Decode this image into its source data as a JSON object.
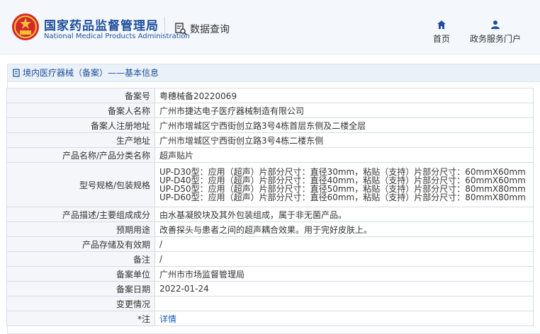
{
  "header": {
    "brand_cn": "国家药品监督管理局",
    "brand_en": "National Medical Products Administration",
    "data_query": "数据查询",
    "nav": [
      {
        "label": "首页",
        "icon": "home-icon"
      },
      {
        "label": "政务服务门户",
        "icon": "user-icon"
      }
    ]
  },
  "panel": {
    "title": "境内医疗器械（备案）——基本信息"
  },
  "rows": [
    {
      "label": "备案号",
      "value": "粤穗械备20220069"
    },
    {
      "label": "备案人名称",
      "value": "广州市捷达电子医疗器械制造有限公司"
    },
    {
      "label": "备案人注册地址",
      "value": "广州市增城区宁西街创立路3号4栋首层东侧及二楼全层"
    },
    {
      "label": "生产地址",
      "value": "广州市增城区宁西街创立路3号4栋二楼东侧"
    },
    {
      "label": "产品名称/产品分类名称",
      "value": "超声贴片"
    },
    {
      "label": "型号规格/包装规格",
      "lines": [
        "UP-D30型：应用（超声）片部分尺寸：直径30mm，粘贴（支持）片部分尺寸：60mmX60mm",
        "UP-D40型：应用（超声）片部分尺寸：直径40mm，粘贴（支持）片部分尺寸：60mmX60mm",
        "UP-D50型：应用（超声）片部分尺寸：直径50mm，粘贴（支持）片部分尺寸：80mmX80mm",
        "UP-D60型：应用（超声）片部分尺寸：直径60mm，粘贴（支持）片部分尺寸：80mmX80mm"
      ]
    },
    {
      "label": "产品描述/主要组成成分",
      "value": "由水基凝胶块及其外包装组成，属于非无菌产品。"
    },
    {
      "label": "预期用途",
      "value": "改善探头与患者之间的超声耦合效果。用于完好皮肤上。"
    },
    {
      "label": "产品存储及有效期",
      "value": "/"
    },
    {
      "label": "备注",
      "value": "/"
    },
    {
      "label": "备案单位",
      "value": "广州市市场监督管理局"
    },
    {
      "label": "备案日期",
      "value": "2022-01-24"
    },
    {
      "label": "变更情况",
      "value": ""
    },
    {
      "label": "*注",
      "value": "详情"
    }
  ],
  "colors": {
    "brand_blue": "#1f4e9c",
    "link": "#1f5cc0"
  }
}
